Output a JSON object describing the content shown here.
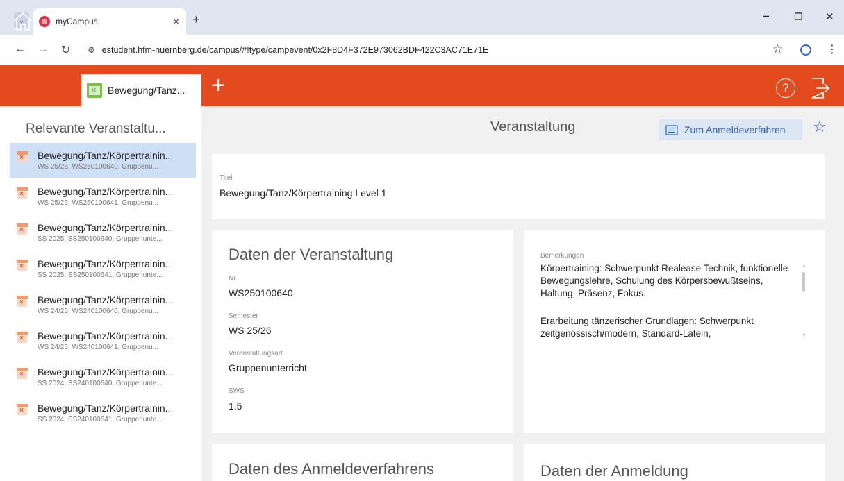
{
  "browser": {
    "tab_title": "myCampus",
    "tab_close": "×",
    "new_tab": "+",
    "url": "estudent.hfm-nuernberg.de/campus/#!type/campevent/0x2F8D4F372E973062BDF422C3AC71E71E",
    "window_controls": {
      "minimize": "−",
      "restore": "❐",
      "close": "✕"
    }
  },
  "app": {
    "open_tab_label": "Bewegung/Tanz...",
    "help_label": "?"
  },
  "sidebar": {
    "title": "Relevante Veranstaltu...",
    "items": [
      {
        "title": "Bewegung/Tanz/Körpertrainin...",
        "subtitle": "WS 25/26, WS250100640, Gruppenu...",
        "active": true
      },
      {
        "title": "Bewegung/Tanz/Körpertrainin...",
        "subtitle": "WS 25/26, WS250100641, Gruppenu...",
        "active": false
      },
      {
        "title": "Bewegung/Tanz/Körpertrainin...",
        "subtitle": "SS 2025, SS250100640, Gruppenunte...",
        "active": false
      },
      {
        "title": "Bewegung/Tanz/Körpertrainin...",
        "subtitle": "SS 2025, SS250100641, Gruppenunte...",
        "active": false
      },
      {
        "title": "Bewegung/Tanz/Körpertrainin...",
        "subtitle": "WS 24/25, WS240100640, Gruppenu...",
        "active": false
      },
      {
        "title": "Bewegung/Tanz/Körpertrainin...",
        "subtitle": "WS 24/25, WS240100641, Gruppenu...",
        "active": false
      },
      {
        "title": "Bewegung/Tanz/Körpertrainin...",
        "subtitle": "SS 2024, SS240100640, Gruppenunte...",
        "active": false
      },
      {
        "title": "Bewegung/Tanz/Körpertrainin...",
        "subtitle": "SS 2024, SS240100641, Gruppenunte...",
        "active": false
      }
    ]
  },
  "main": {
    "title": "Veranstaltung",
    "register_button": "Zum Anmeldeverfahren",
    "title_card": {
      "label": "Titel",
      "value": "Bewegung/Tanz/Körpertraining Level 1"
    },
    "event_card": {
      "heading": "Daten der Veranstaltung",
      "fields": [
        {
          "label": "Nr.",
          "value": "WS250100640"
        },
        {
          "label": "Semester",
          "value": "WS 25/26"
        },
        {
          "label": "Veranstaltungsart",
          "value": "Gruppenunterricht"
        },
        {
          "label": "SWS",
          "value": "1,5"
        }
      ]
    },
    "remarks_card": {
      "label": "Bemerkungen",
      "paragraph1": "Körpertraining: Schwerpunkt Realease Technik, funktionelle Bewegungslehre, Schulung des Körpersbewußtseins, Haltung, Präsenz, Fokus.",
      "paragraph2": "Erarbeitung tänzerischer Grundlagen: Schwerpunkt zeitgenössisch/modern, Standard-Latein,"
    },
    "registration_procedure_heading": "Daten des Anmeldeverfahrens",
    "registration_heading": "Daten der Anmeldung"
  },
  "colors": {
    "header_accent": "#e34b1f",
    "active_item": "#cde0f5",
    "link_blue": "#2b62b8"
  }
}
